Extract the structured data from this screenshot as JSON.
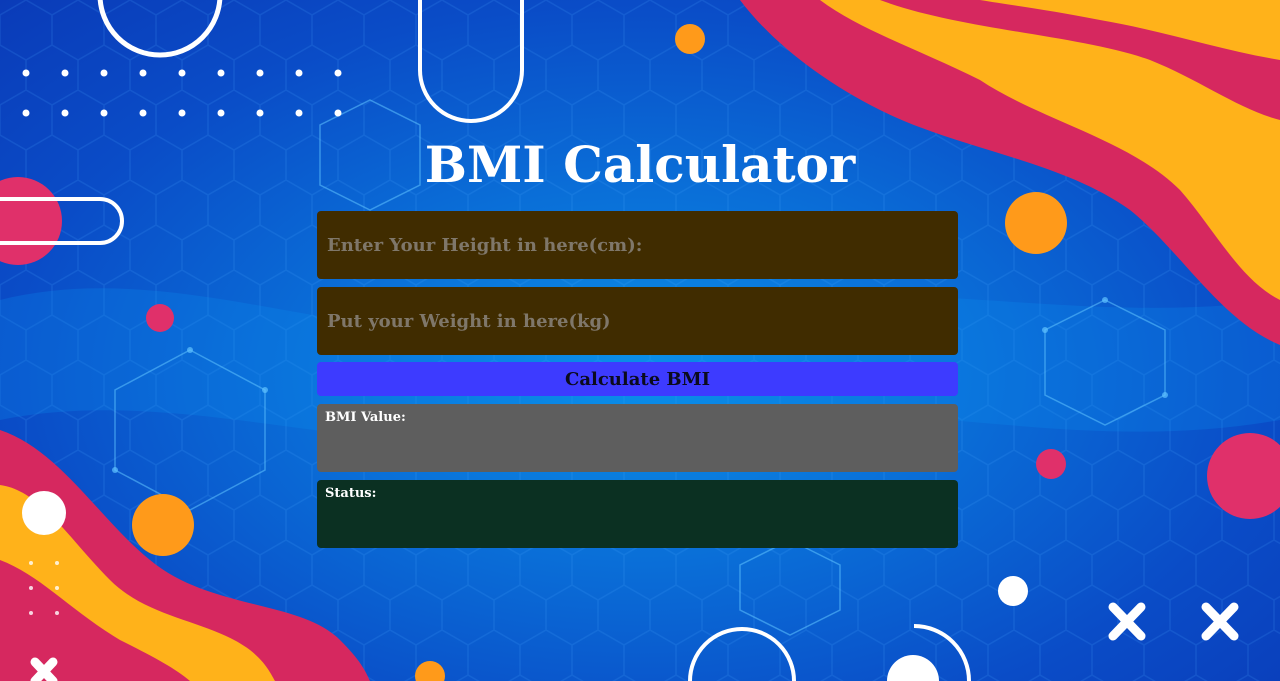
{
  "page": {
    "title": "BMI Calculator"
  },
  "form": {
    "height_placeholder": "Enter Your Height in here(cm):",
    "height_value": "",
    "weight_placeholder": "Put your Weight in here(kg)",
    "weight_value": "",
    "calculate_label": "Calculate BMI"
  },
  "results": {
    "bmi_label": "BMI Value:",
    "bmi_value": "",
    "status_label": "Status:",
    "status_value": ""
  },
  "colors": {
    "field_bg": "#402c00",
    "button_bg": "#3d3bff",
    "bmi_panel_bg": "#5e5e5e",
    "status_panel_bg": "#0b3022",
    "accent_pink": "#e0306a",
    "accent_orange": "#ffa11a",
    "background_blue": "#0a6fd8"
  }
}
